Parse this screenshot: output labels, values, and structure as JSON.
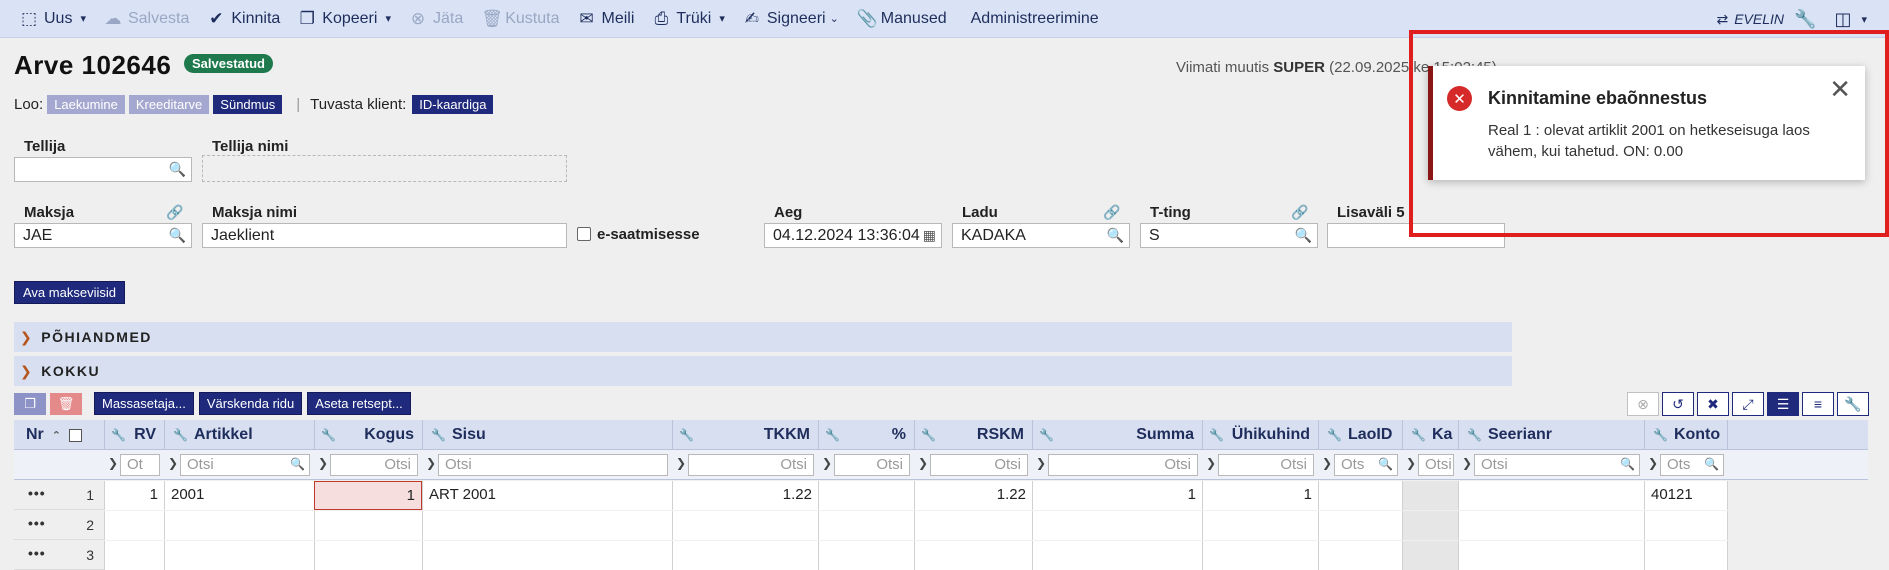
{
  "toolbar": {
    "uus": "Uus",
    "salvesta": "Salvesta",
    "kinnita": "Kinnita",
    "kopeeri": "Kopeeri",
    "jata": "Jäta",
    "kustuta": "Kustuta",
    "meili": "Meili",
    "truki": "Trüki",
    "signeeri": "Signeeri",
    "manused": "Manused",
    "administreerimine": "Administreerimine",
    "user": "EVELIN"
  },
  "header": {
    "title": "Arve 102646",
    "status": "Salvestatud",
    "last_modified_prefix": "Viimati muutis",
    "last_modified_user": "SUPER",
    "last_modified_rest": "(22.09.2025 ke 15:02:45)"
  },
  "loo": {
    "label": "Loo:",
    "buttons": [
      "Laekumine",
      "Kreeditarve",
      "Sündmus"
    ],
    "tuvasta_label": "Tuvasta klient:",
    "tuvasta_button": "ID-kaardiga"
  },
  "fields": {
    "tellija_label": "Tellija",
    "tellija_value": "",
    "tellija_nimi_label": "Tellija nimi",
    "tellija_nimi_value": "",
    "maksja_label": "Maksja",
    "maksja_value": "JAE",
    "maksja_nimi_label": "Maksja nimi",
    "maksja_nimi_value": "Jaeklient",
    "esaatmine_label": "e-saatmisesse",
    "aeg_label": "Aeg",
    "aeg_value": "04.12.2024 13:36:04",
    "ladu_label": "Ladu",
    "ladu_value": "KADAKA",
    "tting_label": "T-ting",
    "tting_value": "S",
    "lisavali_label": "Lisaväli 5",
    "lisavali_value": ""
  },
  "buttons": {
    "ava_makseviisid": "Ava makseviisid",
    "massasetaja": "Massasetaja...",
    "varskenda": "Värskenda ridu",
    "aseta_retsept": "Aseta retsept..."
  },
  "sections": [
    "PÕHIANDMED",
    "KOKKU"
  ],
  "grid": {
    "columns": [
      "Nr",
      "RV",
      "Artikkel",
      "Kogus",
      "Sisu",
      "TKKM",
      "%",
      "RSKM",
      "Summa",
      "Ühikuhind",
      "LaoID",
      "Ka",
      "Seerianr",
      "Konto"
    ],
    "filter_placeholder": "Otsi",
    "filter_short": "Ot",
    "filter_short2": "Ots",
    "rows": [
      {
        "nr": "1",
        "rv": "1",
        "artikkel": "2001",
        "kogus": "1",
        "sisu": "ART 2001",
        "tkkm": "1.22",
        "pct": "",
        "rskm": "1.22",
        "summa": "1",
        "uhikuhind": "1",
        "laoid": "",
        "ka": "",
        "seerianr": "",
        "konto": "40121"
      },
      {
        "nr": "2",
        "rv": "",
        "artikkel": "",
        "kogus": "",
        "sisu": "",
        "tkkm": "",
        "pct": "",
        "rskm": "",
        "summa": "",
        "uhikuhind": "",
        "laoid": "",
        "ka": "",
        "seerianr": "",
        "konto": ""
      },
      {
        "nr": "3",
        "rv": "",
        "artikkel": "",
        "kogus": "",
        "sisu": "",
        "tkkm": "",
        "pct": "",
        "rskm": "",
        "summa": "",
        "uhikuhind": "",
        "laoid": "",
        "ka": "",
        "seerianr": "",
        "konto": ""
      }
    ]
  },
  "toast": {
    "title": "Kinnitamine ebaõnnestus",
    "message": "Real 1 : olevat artiklit 2001 on hetkeseisuga laos vähem, kui tahetud. ON: 0.00"
  }
}
